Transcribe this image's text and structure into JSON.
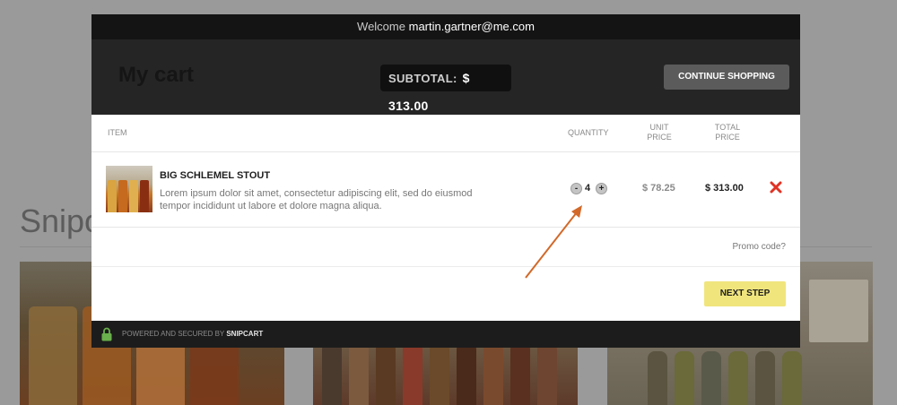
{
  "background": {
    "title": "Snipo"
  },
  "modal": {
    "welcome_prefix": "Welcome",
    "email": "martin.gartner@me.com",
    "cart_title": "My cart",
    "subtotal_label": "SUBTOTAL:",
    "subtotal_value": "$ 313.00",
    "continue_label": "CONTINUE SHOPPING",
    "columns": {
      "item": "ITEM",
      "quantity": "QUANTITY",
      "unit_price_line1": "UNIT",
      "unit_price_line2": "PRICE",
      "total_price_line1": "TOTAL",
      "total_price_line2": "PRICE"
    },
    "item": {
      "name": "BIG SCHLEMEL STOUT",
      "description": "Lorem ipsum dolor sit amet, consectetur adipiscing elit, sed do eiusmod tempor incididunt ut labore et dolore magna aliqua.",
      "quantity": "4",
      "minus_symbol": "-",
      "plus_symbol": "+",
      "unit_price": "$ 78.25",
      "total_price": "$ 313.00"
    },
    "promo_label": "Promo code?",
    "next_label": "NEXT STEP",
    "footer_text": "POWERED AND SECURED BY",
    "footer_brand": "SNIPCART"
  },
  "icons": {
    "remove": "close-x-icon",
    "lock": "lock-icon",
    "annotation": "annotation-arrow"
  },
  "colors": {
    "accent_button": "#f0e57d",
    "remove_icon": "#e03224",
    "lock_icon": "#6ab04c",
    "annotation_arrow": "#d2692a"
  }
}
